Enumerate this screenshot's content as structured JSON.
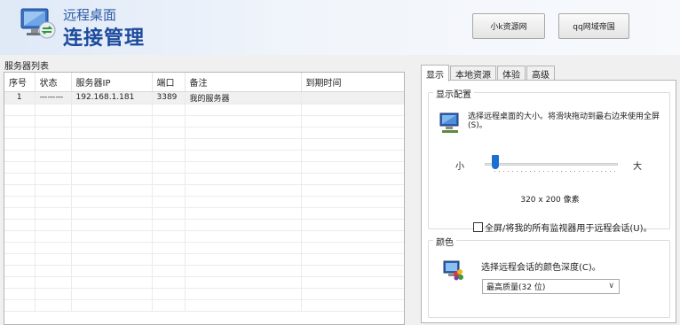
{
  "header": {
    "title_small": "远程桌面",
    "title_big": "连接管理",
    "buttons": [
      "小k资源网",
      "qq网域帝国"
    ]
  },
  "server_list": {
    "title": "服务器列表",
    "columns": [
      "序号",
      "状态",
      "服务器IP",
      "端口",
      "备注",
      "到期时间"
    ],
    "rows": [
      {
        "idx": "1",
        "status": "———",
        "ip": "192.168.1.181",
        "port": "3389",
        "note": "我的服务器",
        "expire": ""
      }
    ]
  },
  "tabs": [
    "显示",
    "本地资源",
    "体验",
    "高级"
  ],
  "display_group": {
    "label": "显示配置",
    "description": "选择远程桌面的大小。将滑块拖动到最右边来使用全屏(S)。",
    "slider_min_label": "小",
    "slider_max_label": "大",
    "slider_value": 0,
    "resolution_text": "320 x 200 像素",
    "fullscreen_checkbox": "全屏/将我的所有监视器用于远程会话(U)。",
    "fullscreen_checked": false
  },
  "color_group": {
    "label": "颜色",
    "description": "选择远程会话的颜色深度(C)。",
    "selected": "最高质量(32 位)"
  }
}
